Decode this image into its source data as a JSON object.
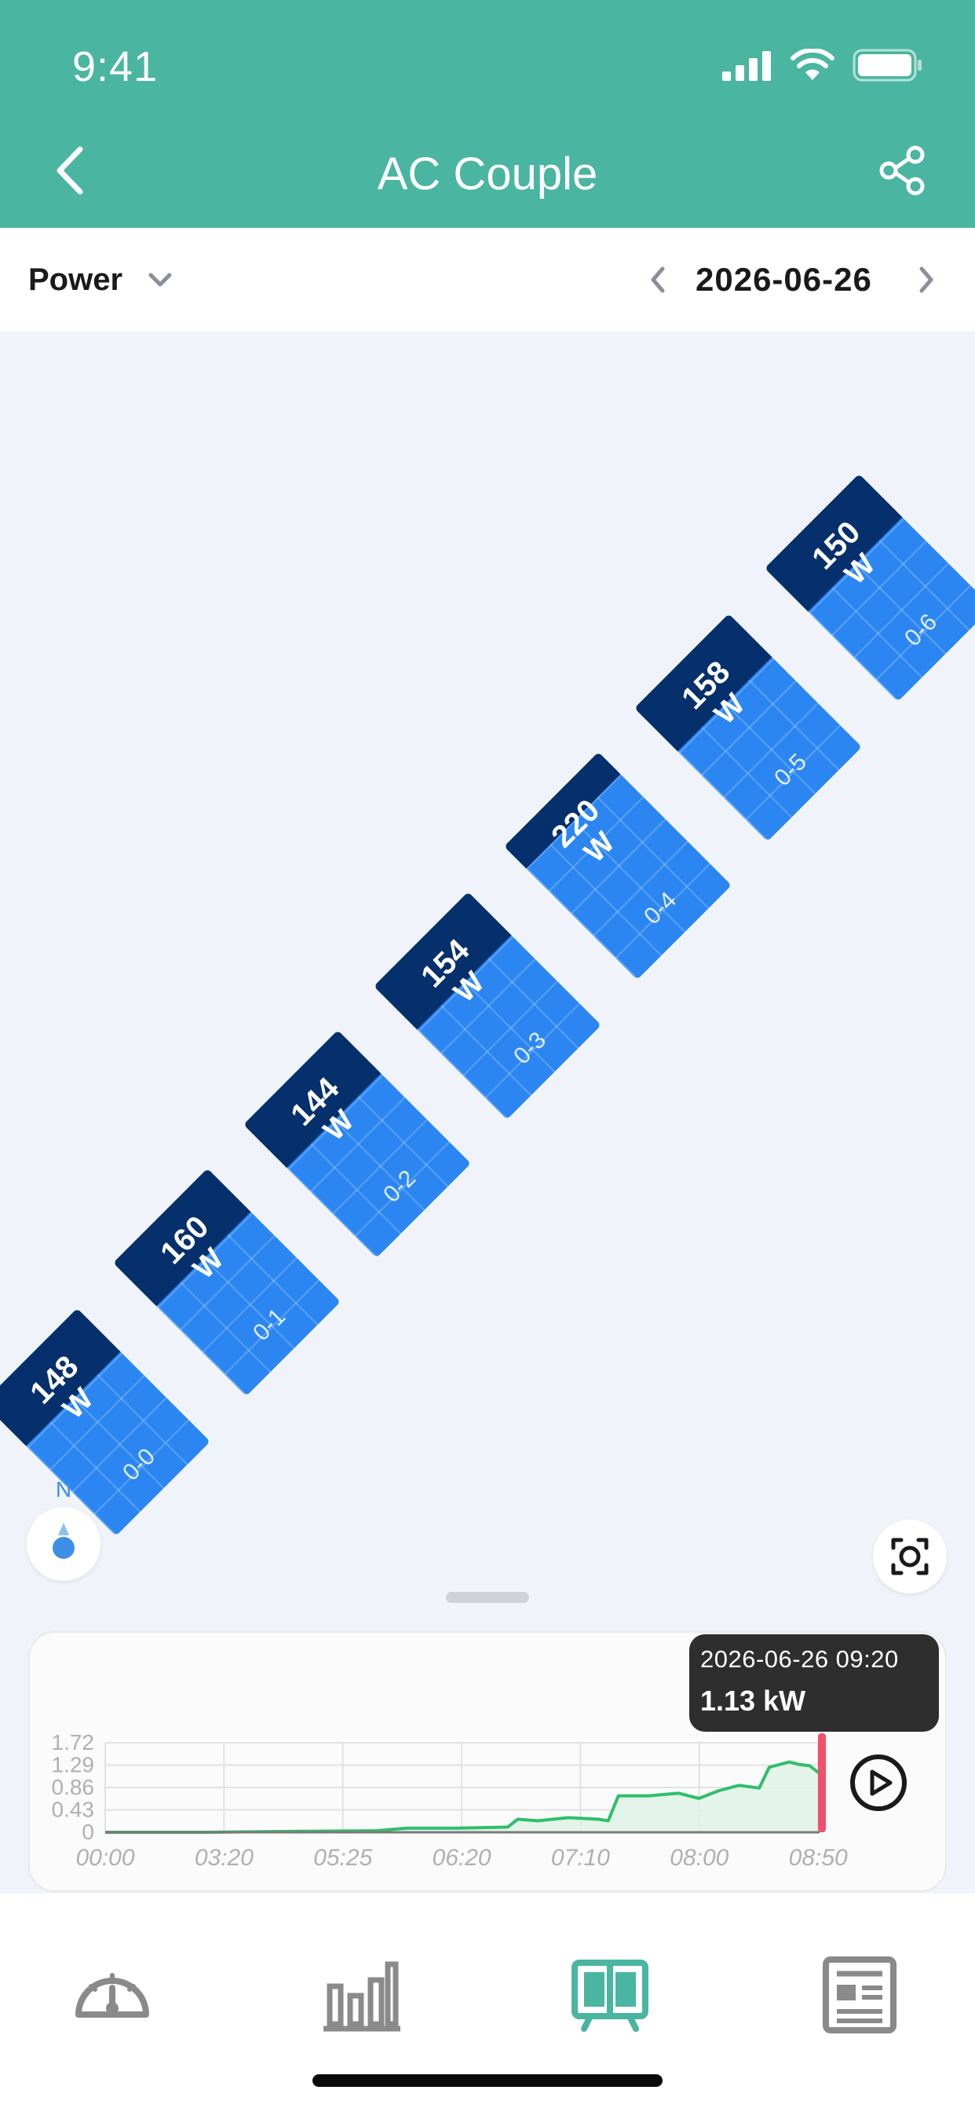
{
  "status_bar": {
    "time": "9:41"
  },
  "header": {
    "title": "AC Couple"
  },
  "toolbar": {
    "metric": "Power",
    "date": "2026-06-26"
  },
  "layout": {
    "compass_label": "N",
    "panels": [
      {
        "id": "0-0",
        "power": "148",
        "unit": "W"
      },
      {
        "id": "0-1",
        "power": "160",
        "unit": "W"
      },
      {
        "id": "0-2",
        "power": "144",
        "unit": "W"
      },
      {
        "id": "0-3",
        "power": "154",
        "unit": "W"
      },
      {
        "id": "0-4",
        "power": "220",
        "unit": "W"
      },
      {
        "id": "0-5",
        "power": "158",
        "unit": "W"
      },
      {
        "id": "0-6",
        "power": "150",
        "unit": "W"
      }
    ]
  },
  "tooltip": {
    "time": "2026-06-26 09:20",
    "value": "1.13 kW"
  },
  "chart_data": {
    "type": "area",
    "title": "",
    "xlabel": "",
    "ylabel": "",
    "x_ticks": [
      "00:00",
      "03:20",
      "05:25",
      "06:20",
      "07:10",
      "08:00",
      "08:50"
    ],
    "y_ticks": [
      "0",
      "0.43",
      "0.86",
      "1.29",
      "1.72"
    ],
    "ylim": [
      0,
      1.72
    ],
    "series": [
      {
        "x": [
          0,
          1,
          2,
          2.7,
          3,
          3.5,
          4,
          4.1,
          4.3,
          4.6,
          4.9,
          5.0,
          5.1,
          5.4,
          5.7,
          5.9,
          6.1,
          6.3,
          6.5,
          6.6,
          6.8,
          6.9,
          7.0,
          7.1
        ],
        "y": [
          0,
          0,
          0.02,
          0.03,
          0.08,
          0.08,
          0.1,
          0.25,
          0.22,
          0.28,
          0.25,
          0.22,
          0.7,
          0.7,
          0.75,
          0.65,
          0.8,
          0.9,
          0.85,
          1.25,
          1.35,
          1.3,
          1.28,
          1.13
        ]
      }
    ],
    "cursor_x": 7.1,
    "grid": true,
    "colors": {
      "line": "#2fbf6b",
      "fill": "#dff3e6",
      "cursor": "#f0506a"
    }
  },
  "colors": {
    "header": "#4ab5a0",
    "panel": "#2b86f2",
    "panel_dark": "#06306b",
    "tab_active": "#4ab5a0",
    "tab_inactive": "#8a8a8a"
  }
}
